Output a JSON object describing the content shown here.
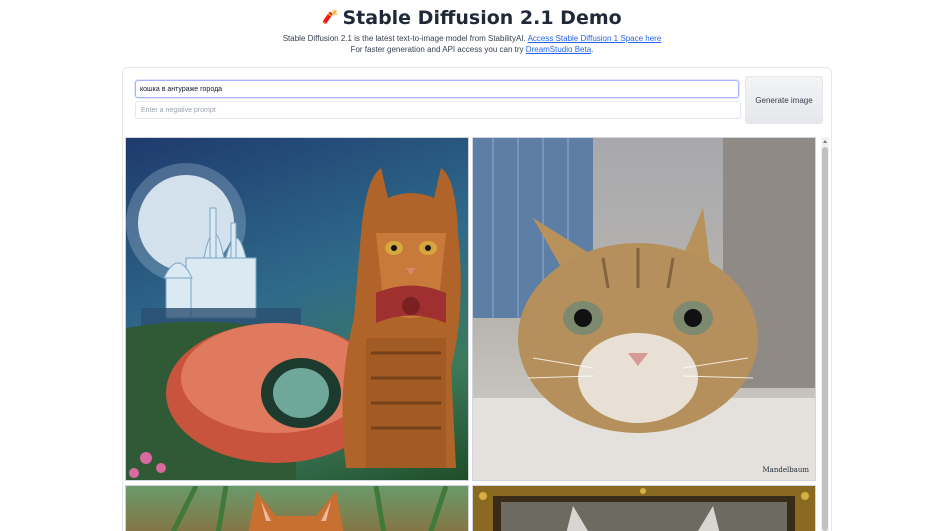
{
  "header": {
    "emoji": "🧨",
    "title": "Stable Diffusion 2.1 Demo",
    "desc_line1_text": "Stable Diffusion 2.1 is the latest text-to-image model from StabilityAI.",
    "desc_line1_link": "Access Stable Diffusion 1 Space here",
    "desc_line2_text": "For faster generation and API access you can try",
    "desc_line2_link": "DreamStudio Beta",
    "desc_line2_end": "."
  },
  "form": {
    "prompt_value": "кошка в антураже города",
    "negative_placeholder": "Enter a negative prompt",
    "generate_label": "Generate image"
  },
  "gallery": {
    "images": [
      {
        "alt": "cat-fairytale-city"
      },
      {
        "alt": "cat-closeup-window",
        "signature": "Mandelbaum"
      },
      {
        "alt": "cat-garden"
      },
      {
        "alt": "cat-framed-portrait"
      }
    ]
  }
}
